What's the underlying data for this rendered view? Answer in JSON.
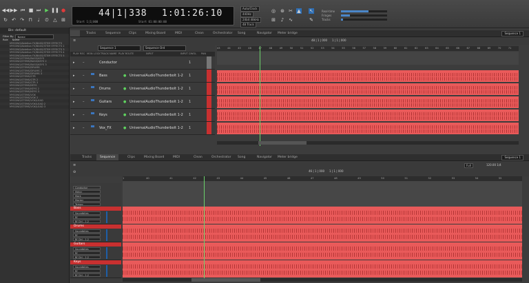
{
  "transport": {
    "counter_main": "44|1|338",
    "counter_secondary": "1:01:26:10",
    "counter_main_sub": "Start 1|1|000",
    "counter_secondary_sub": "Start 01:00:00:00",
    "status_chips": [
      "Auto/Clock",
      "440Hz",
      "24bit 48kHz",
      "48 Track"
    ],
    "right_labels": [
      "Real-time",
      "Fringes",
      "Tracks"
    ],
    "icons": [
      "rewind-icon",
      "fast-forward-icon",
      "go-to-start-icon",
      "go-to-end-icon",
      "stop-icon",
      "play-icon",
      "record-icon",
      "loop-icon",
      "punch-icon",
      "undo-icon",
      "redo-icon"
    ]
  },
  "bin": {
    "title": "Bin: default",
    "filter_label": "Filter By",
    "filter_value": "Name",
    "col_headers": [
      "Role",
      "Name"
    ],
    "items": [
      "MYSONG/Ablelton FX/BASS/STEM EFFECTS",
      "MYSONG/Ablelton FX/BASS/STEM EFFECTS 2",
      "MYSONG/Ablelton FX/BASS/STEM EFFECTS 3",
      "MYSONG/Ablelton FX/BASS/STEM EFFECTS 4",
      "MYSONG/Ablelton FX/BASS/STEM EFFECTS 5",
      "MYSONG/STEMS/BASS/KEYS",
      "MYSONG/STEMS/BASS/KEYS 2",
      "MYSONG/STEMS/BASS/KEYS 3",
      "MYSONG/STEMS/DRUMS",
      "MYSONG/STEMS/DRUMS 2",
      "MYSONG/STEMS/DRUMS 3",
      "MYSONG/STEMS/GTR",
      "MYSONG/STEMS/GTR 2",
      "MYSONG/STEMS/GTR 3",
      "MYSONG/STEMS/KEYS",
      "MYSONG/STEMS/KEYS 2",
      "MYSONG/STEMS/KEYS 3",
      "MYSONG/STEMS/VOX",
      "MYSONG/STEMS/VOX 2",
      "MYSONG/STEMS/VOX/LEAD",
      "MYSONG/STEMS/VOX/LEAD 2",
      "MYSONG/STEMS/VOX/LEAD 3"
    ]
  },
  "tabs_upper": [
    "Tracks",
    "Sequence",
    "Clips",
    "Mixing Board",
    "MIDI",
    "Clean",
    "Orchestrator",
    "Song",
    "Navigator",
    "Meter bridge"
  ],
  "tabs_lower": [
    "Tracks",
    "Sequence",
    "Clips",
    "Mixing Board",
    "MIDI",
    "Clean",
    "Orchestrator",
    "Song",
    "Navigator",
    "Meter bridge"
  ],
  "upper_sequence": "Sequence 1",
  "lower_sequence": "Sequence 1",
  "upper_toolbar": {
    "seq_field": "Sequence 1",
    "seq_field2": "Sequence Ord",
    "ruler_text": "48 | 1 | 000",
    "ruler_text2": "1 | 1 | 000"
  },
  "upper_columns": [
    "PLAY",
    "REC",
    "MON",
    "LOCK",
    "TRACK NAME",
    "PLAY ROUTE",
    "INPUT",
    "INPUT CH",
    "VOL",
    "PAN"
  ],
  "upper_tracks": [
    {
      "name": "Conductor",
      "route": "",
      "ch": "1"
    },
    {
      "name": "Bass",
      "route": "UniversalAudioThunderbolt 1-2",
      "ch": "1"
    },
    {
      "name": "Drums",
      "route": "UniversalAudioThunderbolt 1-2",
      "ch": "1"
    },
    {
      "name": "Guitars",
      "route": "UniversalAudioThunderbolt 1-2",
      "ch": "1"
    },
    {
      "name": "Keys",
      "route": "UniversalAudioThunderbolt 1-2",
      "ch": "1"
    },
    {
      "name": "Vox_FX",
      "route": "UniversalAudioThunderbolt 1-2",
      "ch": "1"
    }
  ],
  "upper_ruler": [
    "43",
    "44",
    "45",
    "46",
    "47",
    "48",
    "49",
    "50",
    "51",
    "52",
    "53",
    "54",
    "55",
    "56",
    "57",
    "58",
    "59",
    "60",
    "61",
    "62",
    "63",
    "64",
    "65",
    "66",
    "67",
    "68",
    "69",
    "70",
    "71"
  ],
  "lower_toolbar": {
    "field1": "46 | 1 | 000",
    "field2": "1 | 1 | 000",
    "zoom": "Full",
    "tempo": "120.00 1/4"
  },
  "lower_ruler": [
    "1",
    "40",
    "41",
    "42",
    "43",
    "44",
    "45",
    "46",
    "47",
    "48",
    "49",
    "50",
    "51",
    "52",
    "53",
    "54",
    "55"
  ],
  "lower_panel": {
    "items": [
      "Conductor",
      "Meter",
      "Mark",
      "Marker",
      "Tempo"
    ]
  },
  "lower_tracks": [
    {
      "name": "Bass",
      "sub1": "Soundbites",
      "sub2": "Rf",
      "sub3": "Bf Ctrl - 1.2"
    },
    {
      "name": "Drums",
      "sub1": "Soundbites",
      "sub2": "Rf",
      "sub3": "Bf Ctrl - 1.2"
    },
    {
      "name": "Guitars",
      "sub1": "Soundbites",
      "sub2": "Rf",
      "sub3": "Bf Ctrl - 1.2"
    },
    {
      "name": "Keys",
      "sub1": "Soundbites",
      "sub2": "Rf",
      "sub3": "Bf Ctrl - 1.2"
    }
  ],
  "colors": {
    "track_red": "#e95a5a",
    "track_dark_red": "#c83030",
    "playhead": "#6bd36b",
    "bg": "#3c3c3c"
  }
}
